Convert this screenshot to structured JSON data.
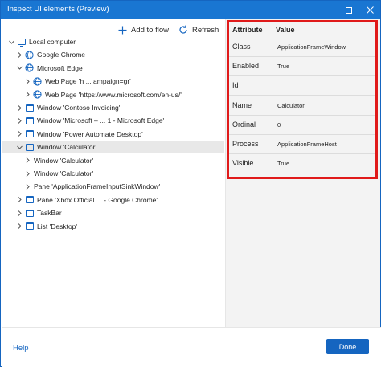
{
  "window": {
    "title": "Inspect UI elements (Preview)",
    "accent": "#1976d2"
  },
  "toolbar": {
    "add_to_flow": "Add to flow",
    "refresh": "Refresh"
  },
  "tree": [
    {
      "label": "Local computer",
      "icon": "computer-icon",
      "expanded": true
    },
    {
      "label": "Google Chrome",
      "icon": "globe-icon",
      "expanded": false
    },
    {
      "label": "Microsoft Edge",
      "icon": "globe-icon",
      "expanded": true
    },
    {
      "label": "Web Page 'h ... ampaign=gr'",
      "icon": "globe-icon",
      "expanded": false
    },
    {
      "label": "Web Page 'https://www.microsoft.com/en-us/'",
      "icon": "globe-icon",
      "expanded": false
    },
    {
      "label": "Window 'Contoso Invoicing'",
      "icon": "window-icon",
      "expanded": false
    },
    {
      "label": "Window 'Microsoft – ... 1 - Microsoft Edge'",
      "icon": "window-icon",
      "expanded": false
    },
    {
      "label": "Window 'Power Automate Desktop'",
      "icon": "window-icon",
      "expanded": false
    },
    {
      "label": "Window 'Calculator'",
      "icon": "window-icon",
      "expanded": true,
      "selected": true
    },
    {
      "label": "Window 'Calculator'",
      "icon": "",
      "expanded": false
    },
    {
      "label": "Window 'Calculator'",
      "icon": "",
      "expanded": false
    },
    {
      "label": "Pane 'ApplicationFrameInputSinkWindow'",
      "icon": "",
      "expanded": false
    },
    {
      "label": "Pane 'Xbox Official ... - Google Chrome'",
      "icon": "window-icon",
      "expanded": false
    },
    {
      "label": "TaskBar",
      "icon": "window-icon",
      "expanded": false
    },
    {
      "label": "List 'Desktop'",
      "icon": "window-icon",
      "expanded": false
    }
  ],
  "attributes": {
    "header_attribute": "Attribute",
    "header_value": "Value",
    "rows": [
      {
        "name": "Class",
        "value": "ApplicationFrameWindow"
      },
      {
        "name": "Enabled",
        "value": "True"
      },
      {
        "name": "Id",
        "value": ""
      },
      {
        "name": "Name",
        "value": "Calculator"
      },
      {
        "name": "Ordinal",
        "value": "0"
      },
      {
        "name": "Process",
        "value": "ApplicationFrameHost"
      },
      {
        "name": "Visible",
        "value": "True"
      }
    ],
    "highlight_color": "#e01a1a"
  },
  "footer": {
    "help": "Help",
    "done": "Done"
  }
}
